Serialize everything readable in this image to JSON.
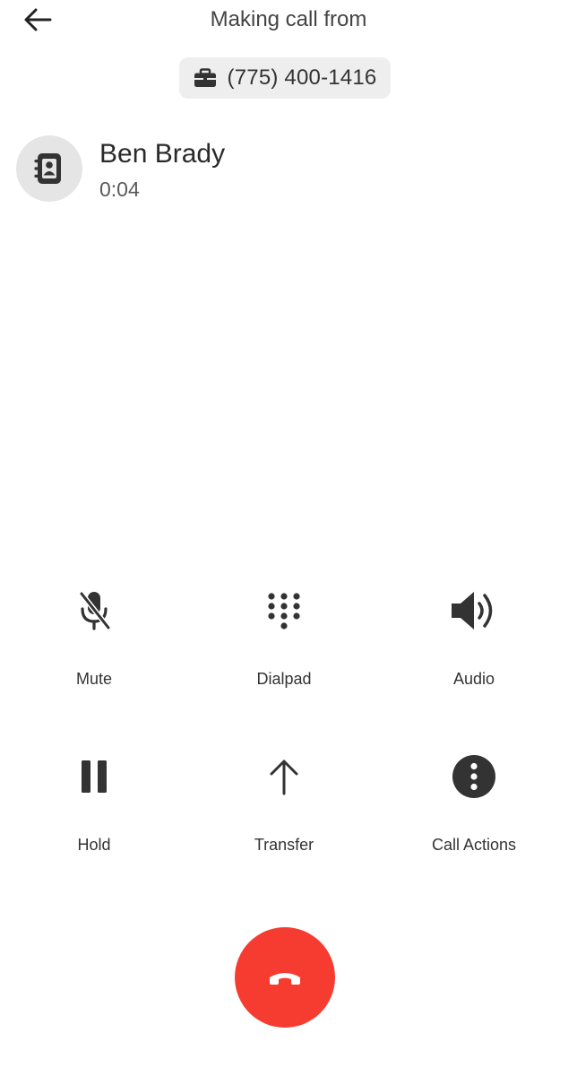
{
  "header": {
    "title": "Making call from"
  },
  "from_number": {
    "icon": "briefcase-icon",
    "number": "(775) 400-1416"
  },
  "contact": {
    "icon": "contact-book-icon",
    "name": "Ben Brady",
    "duration": "0:04"
  },
  "controls": [
    {
      "label": "Mute",
      "icon": "mic-off-icon"
    },
    {
      "label": "Dialpad",
      "icon": "dialpad-icon"
    },
    {
      "label": "Audio",
      "icon": "speaker-icon"
    },
    {
      "label": "Hold",
      "icon": "pause-icon"
    },
    {
      "label": "Transfer",
      "icon": "arrow-up-icon"
    },
    {
      "label": "Call Actions",
      "icon": "more-vertical-icon"
    }
  ],
  "end_call": {
    "icon": "hang-up-icon",
    "color": "#f63c30"
  },
  "colors": {
    "icon": "#333333",
    "chip_bg": "#eeeeee",
    "avatar_bg": "#e5e5e5"
  }
}
